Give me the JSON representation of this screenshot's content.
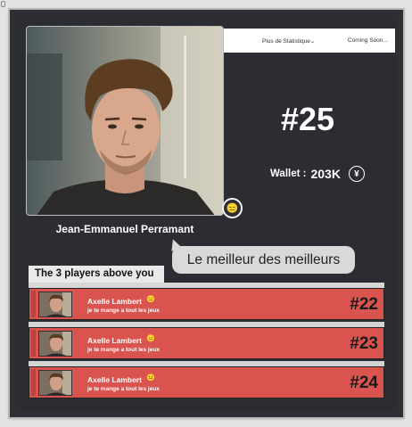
{
  "nav": {
    "stats_link": "Plus de Statistique",
    "coming_soon": "Coming Soon..."
  },
  "profile": {
    "name": "Jean-Emmanuel Perramant",
    "rank": "#25",
    "wallet_label": "Wallet :",
    "wallet_value": "203K",
    "currency_symbol": "¥",
    "status_emoji": "😑",
    "quote": "Le meilleur des meilleurs"
  },
  "leaderboard": {
    "title": "The 3 players above you",
    "rows": [
      {
        "name": "Axelle Lambert",
        "emoji": "😑",
        "status": "je te mange a tout les jeux",
        "rank": "#22"
      },
      {
        "name": "Axelle Lambert",
        "emoji": "😑",
        "status": "je te mange a tout les jeux",
        "rank": "#23"
      },
      {
        "name": "Axelle Lambert",
        "emoji": "😐",
        "status": "je te mange a tout les jeux",
        "rank": "#24"
      }
    ]
  },
  "colors": {
    "panel_bg": "#2b2d33",
    "row_red": "#d9534f",
    "bubble_grey": "#d9d9d9"
  }
}
